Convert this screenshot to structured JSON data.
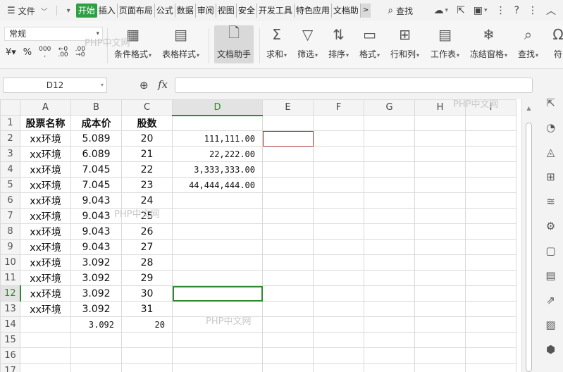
{
  "menubar": {
    "file_label": "文件",
    "tabs": [
      "开始",
      "插入",
      "页面布局",
      "公式",
      "数据",
      "审阅",
      "视图",
      "安全",
      "开发工具",
      "特色应用",
      "文档助"
    ],
    "more": ">",
    "search_label": "查找"
  },
  "ribbon": {
    "number_format": "常规",
    "buttons": [
      {
        "label": "条件格式",
        "icon": "conditional-format-icon"
      },
      {
        "label": "表格样式",
        "icon": "table-style-icon"
      },
      {
        "label": "文档助手",
        "icon": "doc-assistant-icon"
      },
      {
        "label": "求和",
        "icon": "sum-icon"
      },
      {
        "label": "筛选",
        "icon": "filter-icon"
      },
      {
        "label": "排序",
        "icon": "sort-icon"
      },
      {
        "label": "格式",
        "icon": "format-icon"
      },
      {
        "label": "行和列",
        "icon": "rows-cols-icon"
      },
      {
        "label": "工作表",
        "icon": "worksheet-icon"
      },
      {
        "label": "冻结窗格",
        "icon": "freeze-icon"
      },
      {
        "label": "查找",
        "icon": "find-icon"
      },
      {
        "label": "符",
        "icon": "symbol-icon"
      }
    ]
  },
  "formula_bar": {
    "name_box": "D12",
    "fx": "fx",
    "formula": ""
  },
  "sheet": {
    "columns": [
      "A",
      "B",
      "C",
      "D",
      "E",
      "F",
      "G",
      "H",
      "I"
    ],
    "rows": [
      {
        "n": "1",
        "a": "股票名称",
        "b": "成本价",
        "c": "股数",
        "d": ""
      },
      {
        "n": "2",
        "a": "xx环境",
        "b": "5.089",
        "c": "20",
        "d": "111,111.00"
      },
      {
        "n": "3",
        "a": "xx环境",
        "b": "6.089",
        "c": "21",
        "d": "22,222.00"
      },
      {
        "n": "4",
        "a": "xx环境",
        "b": "7.045",
        "c": "22",
        "d": "3,333,333.00"
      },
      {
        "n": "5",
        "a": "xx环境",
        "b": "7.045",
        "c": "23",
        "d": "44,444,444.00"
      },
      {
        "n": "6",
        "a": "xx环境",
        "b": "9.043",
        "c": "24",
        "d": ""
      },
      {
        "n": "7",
        "a": "xx环境",
        "b": "9.043",
        "c": "25",
        "d": ""
      },
      {
        "n": "8",
        "a": "xx环境",
        "b": "9.043",
        "c": "26",
        "d": ""
      },
      {
        "n": "9",
        "a": "xx环境",
        "b": "9.043",
        "c": "27",
        "d": ""
      },
      {
        "n": "10",
        "a": "xx环境",
        "b": "3.092",
        "c": "28",
        "d": ""
      },
      {
        "n": "11",
        "a": "xx环境",
        "b": "3.092",
        "c": "29",
        "d": ""
      },
      {
        "n": "12",
        "a": "xx环境",
        "b": "3.092",
        "c": "30",
        "d": ""
      },
      {
        "n": "13",
        "a": "xx环境",
        "b": "3.092",
        "c": "31",
        "d": ""
      },
      {
        "n": "14",
        "a": "",
        "b": "3.092",
        "c": "20",
        "d": ""
      },
      {
        "n": "15",
        "a": "",
        "b": "",
        "c": "",
        "d": ""
      },
      {
        "n": "16",
        "a": "",
        "b": "",
        "c": "",
        "d": ""
      },
      {
        "n": "17",
        "a": "",
        "b": "",
        "c": "",
        "d": ""
      }
    ]
  },
  "watermark": "PHP中文网"
}
